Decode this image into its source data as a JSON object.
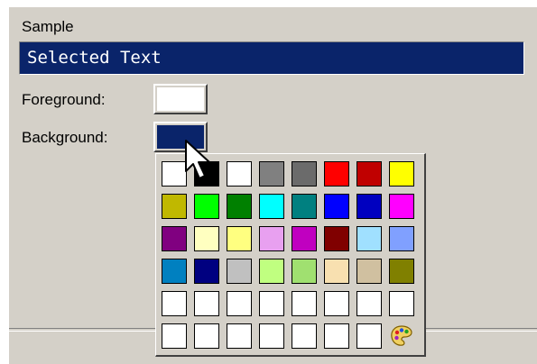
{
  "sample": {
    "label": "Sample",
    "text": "Selected Text",
    "background_color": "#0a246a",
    "text_color": "#ffffff"
  },
  "foreground": {
    "label": "Foreground:",
    "color": "#ffffff"
  },
  "background": {
    "label": "Background:",
    "color": "#0a246a"
  },
  "palette": {
    "colors": [
      [
        "#ffffff",
        "#000000",
        "#ffffff",
        "#808080",
        "#6b6b6b",
        "#ff0000",
        "#c00000",
        "#ffff00"
      ],
      [
        "#c0b800",
        "#00ff00",
        "#008000",
        "#00ffff",
        "#008080",
        "#0000ff",
        "#0000c0",
        "#ff00ff"
      ],
      [
        "#800080",
        "#ffffc0",
        "#ffff80",
        "#e8a0f0",
        "#c000c0",
        "#800000",
        "#a0e0ff",
        "#80a0ff"
      ],
      [
        "#0080c0",
        "#000080",
        "#c0c0c0",
        "#c0ff80",
        "#a0e070",
        "#f8e0b0",
        "#d0c0a0",
        "#808000"
      ],
      [
        "#ffffff",
        "#ffffff",
        "#ffffff",
        "#ffffff",
        "#ffffff",
        "#ffffff",
        "#ffffff",
        "#ffffff"
      ],
      [
        "#ffffff",
        "#ffffff",
        "#ffffff",
        "#ffffff",
        "#ffffff",
        "#ffffff",
        "#ffffff"
      ]
    ],
    "custom_icon": "palette-icon"
  },
  "cursor_icon": "arrow-cursor-icon"
}
